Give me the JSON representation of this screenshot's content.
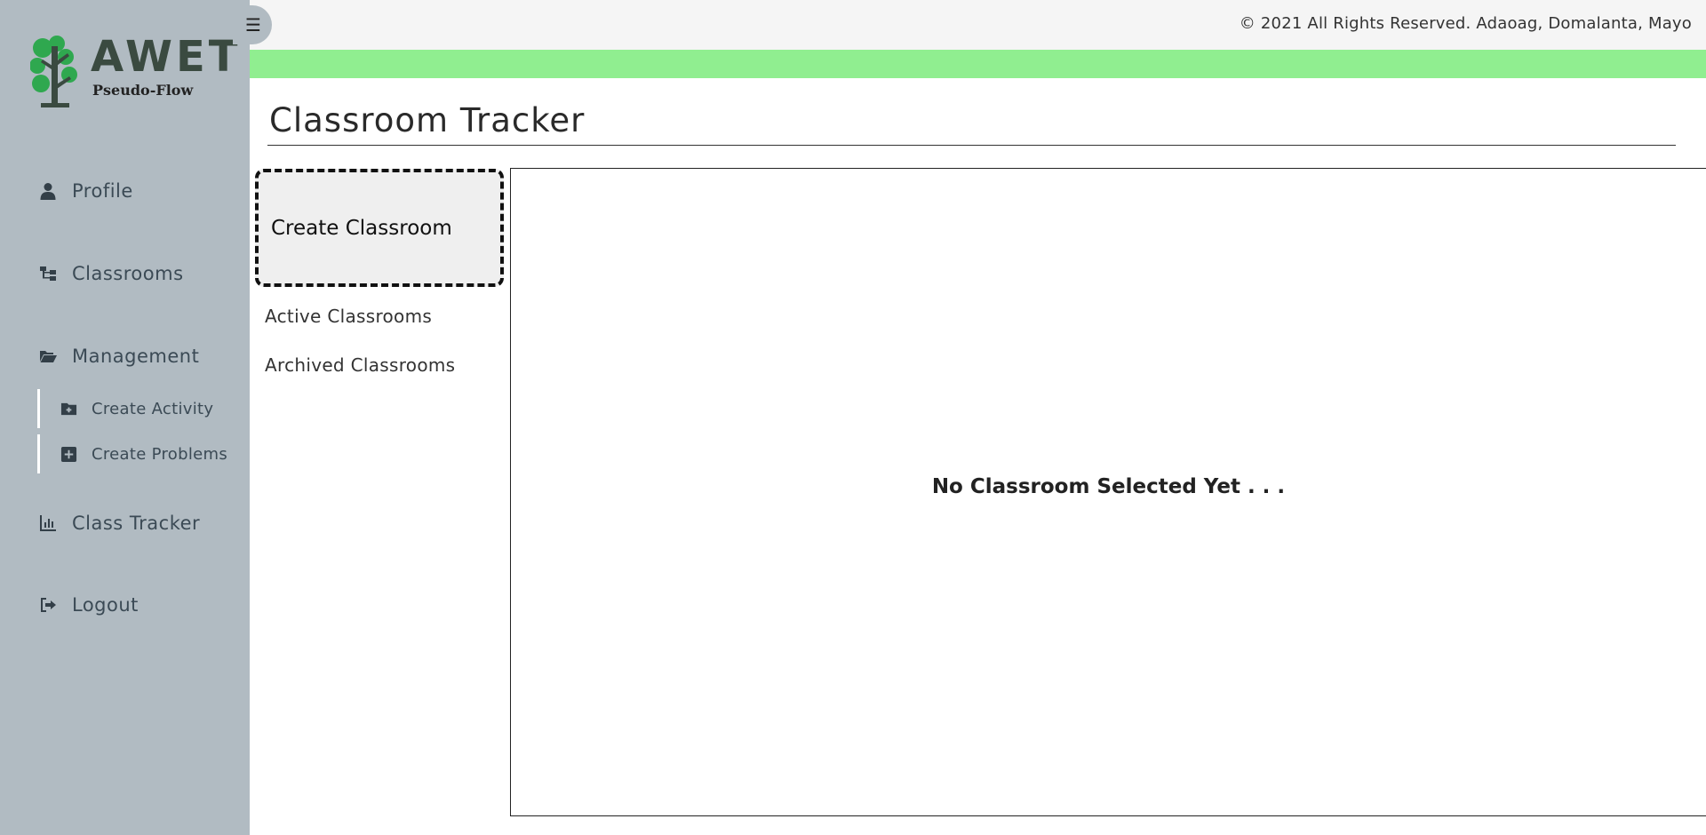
{
  "brand": {
    "title": "AWET",
    "subtitle": "Pseudo-Flow",
    "colors": {
      "leaf": "#2fa84f",
      "trunk": "#3a4a40"
    }
  },
  "sidebar": {
    "items": [
      {
        "label": "Profile",
        "icon": "user-icon"
      },
      {
        "label": "Classrooms",
        "icon": "sitemap-icon"
      },
      {
        "label": "Management",
        "icon": "folder-open-icon"
      },
      {
        "label": "Class Tracker",
        "icon": "chart-bar-icon"
      },
      {
        "label": "Logout",
        "icon": "sign-out-icon"
      }
    ],
    "subitems": [
      {
        "label": "Create Activity",
        "icon": "folder-plus-icon"
      },
      {
        "label": "Create Problems",
        "icon": "plus-square-icon"
      }
    ]
  },
  "header": {
    "copyright": "© 2021 All Rights Reserved. Adaoag, Domalanta, Mayo",
    "toggle_icon": "bars-icon",
    "accent": "#90ee90"
  },
  "main": {
    "title": "Classroom Tracker",
    "create_button": "Create Classroom",
    "tabs": [
      {
        "label": "Active Classrooms"
      },
      {
        "label": "Archived Classrooms"
      }
    ],
    "panel_message": "No Classroom Selected Yet . . ."
  }
}
